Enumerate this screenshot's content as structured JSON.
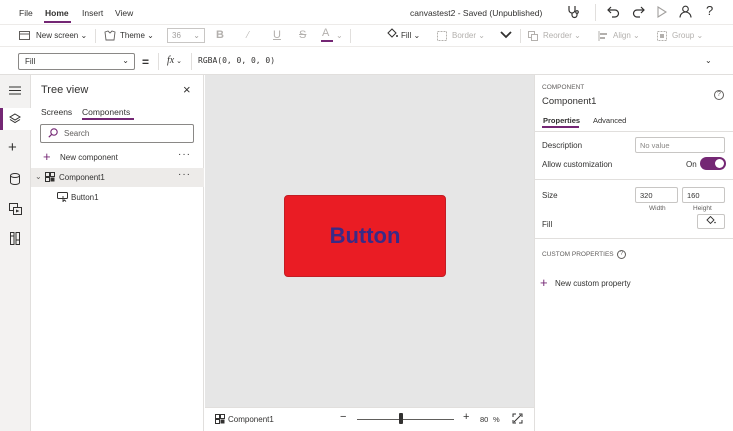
{
  "menu": {
    "file": "File",
    "home": "Home",
    "insert": "Insert",
    "view": "View"
  },
  "app": {
    "title": "canvastest2 - Saved (Unpublished)"
  },
  "toolbar": {
    "new_screen": "New screen",
    "theme": "Theme",
    "font_size": "36",
    "fill": "Fill",
    "border": "Border",
    "reorder": "Reorder",
    "align": "Align",
    "group": "Group"
  },
  "formula": {
    "property": "Fill",
    "equals": "=",
    "fx": "fx",
    "value": "RGBA(0, 0, 0, 0)"
  },
  "tree": {
    "title": "Tree view",
    "tab_screens": "Screens",
    "tab_components": "Components",
    "search_placeholder": "Search",
    "new_component": "New component",
    "items": [
      {
        "label": "Component1"
      },
      {
        "label": "Button1"
      }
    ]
  },
  "canvas": {
    "button_label": "Button"
  },
  "status": {
    "component": "Component1",
    "zoom": "80",
    "zoom_unit": "%",
    "zoom_level": 0.45
  },
  "props": {
    "kind": "COMPONENT",
    "name": "Component1",
    "tab_properties": "Properties",
    "tab_advanced": "Advanced",
    "description_label": "Description",
    "description_placeholder": "No value",
    "allow_label": "Allow customization",
    "allow_state": "On",
    "size_label": "Size",
    "width_value": "320",
    "height_value": "160",
    "width_caption": "Width",
    "height_caption": "Height",
    "fill_label": "Fill",
    "custom_header": "CUSTOM PROPERTIES",
    "new_custom": "New custom property"
  },
  "colors": {
    "accent": "#742774",
    "button_fill": "#ea1c24",
    "button_text": "#3a2a86"
  }
}
